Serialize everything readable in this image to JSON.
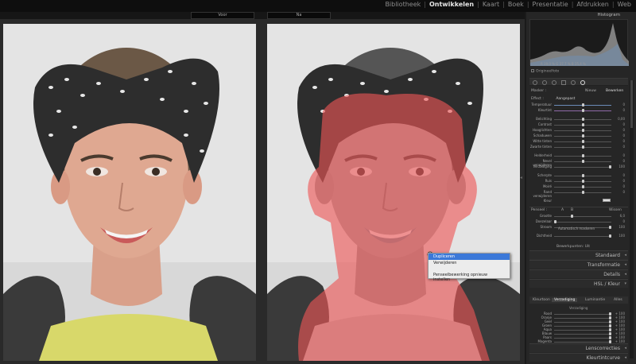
{
  "modules": [
    {
      "label": "Bibliotheek",
      "active": false
    },
    {
      "label": "Ontwikkelen",
      "active": true
    },
    {
      "label": "Kaart",
      "active": false
    },
    {
      "label": "Boek",
      "active": false
    },
    {
      "label": "Presentatie",
      "active": false
    },
    {
      "label": "Afdrukken",
      "active": false
    },
    {
      "label": "Web",
      "active": false
    }
  ],
  "compare": {
    "before_label": "Voor",
    "after_label": "Na"
  },
  "context_menu": {
    "items": [
      "Dupliceren",
      "Verwijderen",
      "Penseelbewerking opnieuw instellen"
    ],
    "highlighted_index": 0
  },
  "panel": {
    "histogram_title": "Histogram",
    "readout": "R 39,0 % G 37,7 % B 25,4 %",
    "original_photo": "Origineelfoto",
    "mask_label": "Masker :",
    "mask_new": "Nieuw",
    "mask_edit": "Bewerken",
    "effect_label": "Effect :",
    "effect_value": "Aangepast",
    "sliders": [
      {
        "label": "Temperatuur",
        "value": "0",
        "pos": 0.5,
        "color": "#6a8bb7"
      },
      {
        "label": "Kleurtint",
        "value": "0",
        "pos": 0.5,
        "color": "#8f6aa8"
      },
      {
        "label": "Belichting",
        "value": "0,00",
        "pos": 0.5
      },
      {
        "label": "Contrast",
        "value": "0",
        "pos": 0.5
      },
      {
        "label": "Hooglichten",
        "value": "0",
        "pos": 0.5
      },
      {
        "label": "Schaduwen",
        "value": "0",
        "pos": 0.5
      },
      {
        "label": "Witte tinten",
        "value": "0",
        "pos": 0.5
      },
      {
        "label": "Zwarte tinten",
        "value": "0",
        "pos": 0.5
      },
      {
        "label": "Helderheid",
        "value": "0",
        "pos": 0.5
      },
      {
        "label": "Nevel verwijderen",
        "value": "0",
        "pos": 0.5
      },
      {
        "label": "Verzadiging",
        "value": "100",
        "pos": 1.0
      },
      {
        "label": "Scherpte",
        "value": "0",
        "pos": 0.5
      },
      {
        "label": "Ruis",
        "value": "0",
        "pos": 0.5
      },
      {
        "label": "Moiré",
        "value": "0",
        "pos": 0.5
      },
      {
        "label": "Rand verwijderen",
        "value": "0",
        "pos": 0.5
      }
    ],
    "color_label": "Kleur",
    "brush": {
      "label": "Penseel :",
      "a": "A",
      "b": "B",
      "erase": "Wissen",
      "sliders": [
        {
          "label": "Grootte",
          "value": "6,0",
          "pos": 0.3
        },
        {
          "label": "Doezelaar",
          "value": "0",
          "pos": 0.0
        },
        {
          "label": "Stroom",
          "value": "100",
          "pos": 1.0
        }
      ],
      "auto_mask": "Automatisch maskeren",
      "density": {
        "label": "Dichtheid",
        "value": "100",
        "pos": 1.0
      }
    },
    "buttons": {
      "edit_points": "Bewerkpunten: Uit",
      "reset": "Opnieuw instellen",
      "close": "Sluiten"
    },
    "sections": [
      "Standaard",
      "Transformatie",
      "Details",
      "HSL / Kleur"
    ],
    "hsl_tabs": [
      "Kleurtoon",
      "Verzadiging",
      "Luminantie",
      "Alles"
    ],
    "hsl_sub": "Verzadiging",
    "hsl_sliders": [
      {
        "label": "Rood",
        "value": "+ 100"
      },
      {
        "label": "Oranje",
        "value": "+ 100"
      },
      {
        "label": "Geel",
        "value": "+ 100"
      },
      {
        "label": "Groen",
        "value": "+ 100"
      },
      {
        "label": "Aqua",
        "value": "+ 100"
      },
      {
        "label": "Blauw",
        "value": "+ 100"
      },
      {
        "label": "Paars",
        "value": "+ 100"
      },
      {
        "label": "Magenta",
        "value": "+ 100"
      }
    ],
    "bottom_sections": [
      "Lenscorrecties",
      "Kleurtintcurve"
    ]
  }
}
